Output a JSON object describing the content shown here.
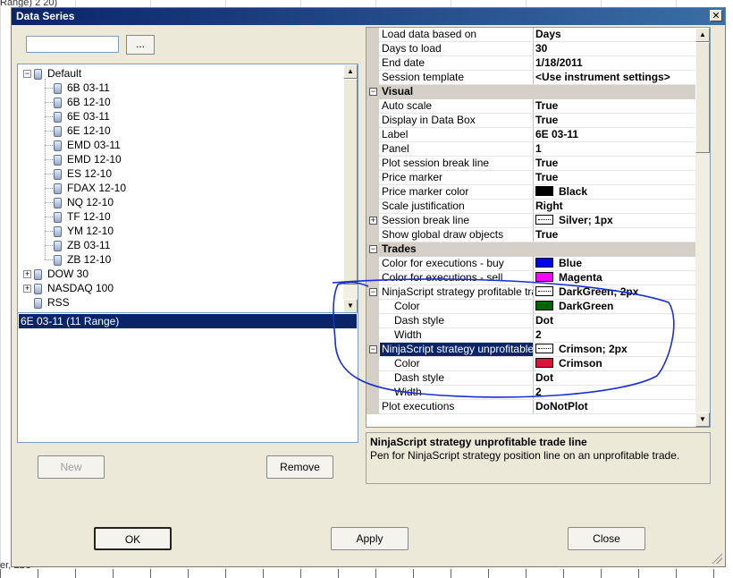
{
  "background": {
    "top_label": "Range) 2 20)",
    "bottom_label": "er, LLC"
  },
  "dialog": {
    "title": "Data Series",
    "close_glyph": "✕"
  },
  "search": {
    "value": "",
    "placeholder": ""
  },
  "browse_label": "...",
  "tree": {
    "groups": [
      {
        "label": "Default",
        "expanded": true,
        "expander": "−",
        "children": [
          "6B 03-11",
          "6B 12-10",
          "6E 03-11",
          "6E 12-10",
          "EMD 03-11",
          "EMD 12-10",
          "ES 12-10",
          "FDAX 12-10",
          "NQ 12-10",
          "TF 12-10",
          "YM 12-10",
          "ZB 03-11",
          "ZB 12-10"
        ]
      },
      {
        "label": "DOW 30",
        "expanded": false,
        "expander": "+"
      },
      {
        "label": "NASDAQ 100",
        "expanded": false,
        "expander": "+"
      },
      {
        "label": "RSS",
        "expanded": false,
        "expander": ""
      }
    ]
  },
  "series_list": {
    "items": [
      "6E 03-11 (11 Range)"
    ]
  },
  "buttons": {
    "new": "New",
    "remove": "Remove",
    "ok": "OK",
    "apply": "Apply",
    "close": "Close"
  },
  "properties": [
    {
      "kind": "prop",
      "name": "Load data based on",
      "value": "Days"
    },
    {
      "kind": "prop",
      "name": "Days to load",
      "value": "30"
    },
    {
      "kind": "prop",
      "name": "End date",
      "value": "1/18/2011"
    },
    {
      "kind": "prop",
      "name": "Session template",
      "value": "<Use instrument settings>"
    },
    {
      "kind": "cat",
      "name": "Visual",
      "toggle": "−"
    },
    {
      "kind": "prop",
      "name": "Auto scale",
      "value": "True"
    },
    {
      "kind": "prop",
      "name": "Display in Data Box",
      "value": "True"
    },
    {
      "kind": "prop",
      "name": "Label",
      "value": "6E 03-11"
    },
    {
      "kind": "prop",
      "name": "Panel",
      "value": "1"
    },
    {
      "kind": "prop",
      "name": "Plot session break line",
      "value": "True"
    },
    {
      "kind": "prop",
      "name": "Price marker",
      "value": "True"
    },
    {
      "kind": "prop",
      "name": "Price marker color",
      "value": "Black",
      "swatch": "#000000"
    },
    {
      "kind": "prop",
      "name": "Scale justification",
      "value": "Right"
    },
    {
      "kind": "prop",
      "name": "Session break line",
      "value": "Silver; 1px",
      "toggle": "+",
      "swatch": "dotline"
    },
    {
      "kind": "prop",
      "name": "Show global draw objects",
      "value": "True"
    },
    {
      "kind": "cat",
      "name": "Trades",
      "toggle": "−"
    },
    {
      "kind": "prop",
      "name": "Color for executions - buy",
      "value": "Blue",
      "swatch": "#0000ff"
    },
    {
      "kind": "prop",
      "name": "Color for executions - sell",
      "value": "Magenta",
      "swatch": "#ff00ff"
    },
    {
      "kind": "prop",
      "name": "NinjaScript strategy profitable trade line",
      "value": "DarkGreen; 2px",
      "toggle": "−",
      "swatch": "dotline"
    },
    {
      "kind": "prop",
      "name": "Color",
      "value": "DarkGreen",
      "swatch": "#006400",
      "indent": true
    },
    {
      "kind": "prop",
      "name": "Dash style",
      "value": "Dot",
      "indent": true
    },
    {
      "kind": "prop",
      "name": "Width",
      "value": "2",
      "indent": true
    },
    {
      "kind": "prop",
      "name": "NinjaScript strategy unprofitable trade line",
      "value": "Crimson; 2px",
      "toggle": "−",
      "swatch": "dotline",
      "selected": true
    },
    {
      "kind": "prop",
      "name": "Color",
      "value": "Crimson",
      "swatch": "#dc143c",
      "indent": true
    },
    {
      "kind": "prop",
      "name": "Dash style",
      "value": "Dot",
      "indent": true
    },
    {
      "kind": "prop",
      "name": "Width",
      "value": "2",
      "indent": true
    },
    {
      "kind": "prop",
      "name": "Plot executions",
      "value": "DoNotPlot"
    }
  ],
  "description": {
    "title": "NinjaScript strategy unprofitable trade line",
    "text": "Pen for NinjaScript strategy position line on an unprofitable trade."
  },
  "colors": {
    "title_bar": "#0a246a",
    "selection": "#0a246a",
    "annotation": "#1a2fd0"
  },
  "scrollbar_glyphs": {
    "up": "▲",
    "down": "▼"
  }
}
